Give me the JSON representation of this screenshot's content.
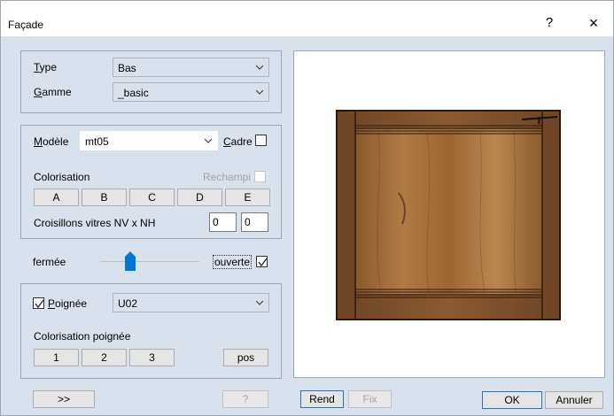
{
  "window": {
    "title": "Façade",
    "help_label": "?",
    "close_label": "×"
  },
  "type_group": {
    "type_label_u": "T",
    "type_label_rest": "ype",
    "type_value": "Bas",
    "gamme_label_u": "G",
    "gamme_label_rest": "amme",
    "gamme_value": "_basic"
  },
  "model_group": {
    "modele_label_u": "M",
    "modele_label_rest": "odèle",
    "modele_value": "mt05",
    "cadre_label_u": "C",
    "cadre_label_rest": "adre",
    "cadre_checked": false,
    "colorisation_label": "Colorisation",
    "rechampi_label": "Rechampi",
    "color_buttons": [
      "A",
      "B",
      "C",
      "D",
      "E"
    ],
    "croisillons_label": "Croisillons vitres NV x NH",
    "nv_value": "0",
    "nh_value": "0"
  },
  "opening": {
    "fermee_label": "fermée",
    "ouverte_label": "ouverte",
    "ouverte_checked": true,
    "slider_fraction": 0.3
  },
  "handle_group": {
    "poignee_checked": true,
    "poignee_label_u": "P",
    "poignee_label_rest": "oignée",
    "poignee_value": "U02",
    "colorisation_poignee_label": "Colorisation poignée",
    "handle_color_buttons": [
      "1",
      "2",
      "3"
    ],
    "pos_label": "pos"
  },
  "footer": {
    "expand_label": ">>",
    "help_disabled_label": "?",
    "rend_label": "Rend",
    "fix_label": "Fix",
    "ok_label": "OK",
    "annuler_label": "Annuler"
  },
  "colors": {
    "dialog_bg": "#d8e1ec",
    "accent_border": "#2b6fc6",
    "door_frame": "#7a4f2a",
    "door_panel": "#a36a35"
  }
}
